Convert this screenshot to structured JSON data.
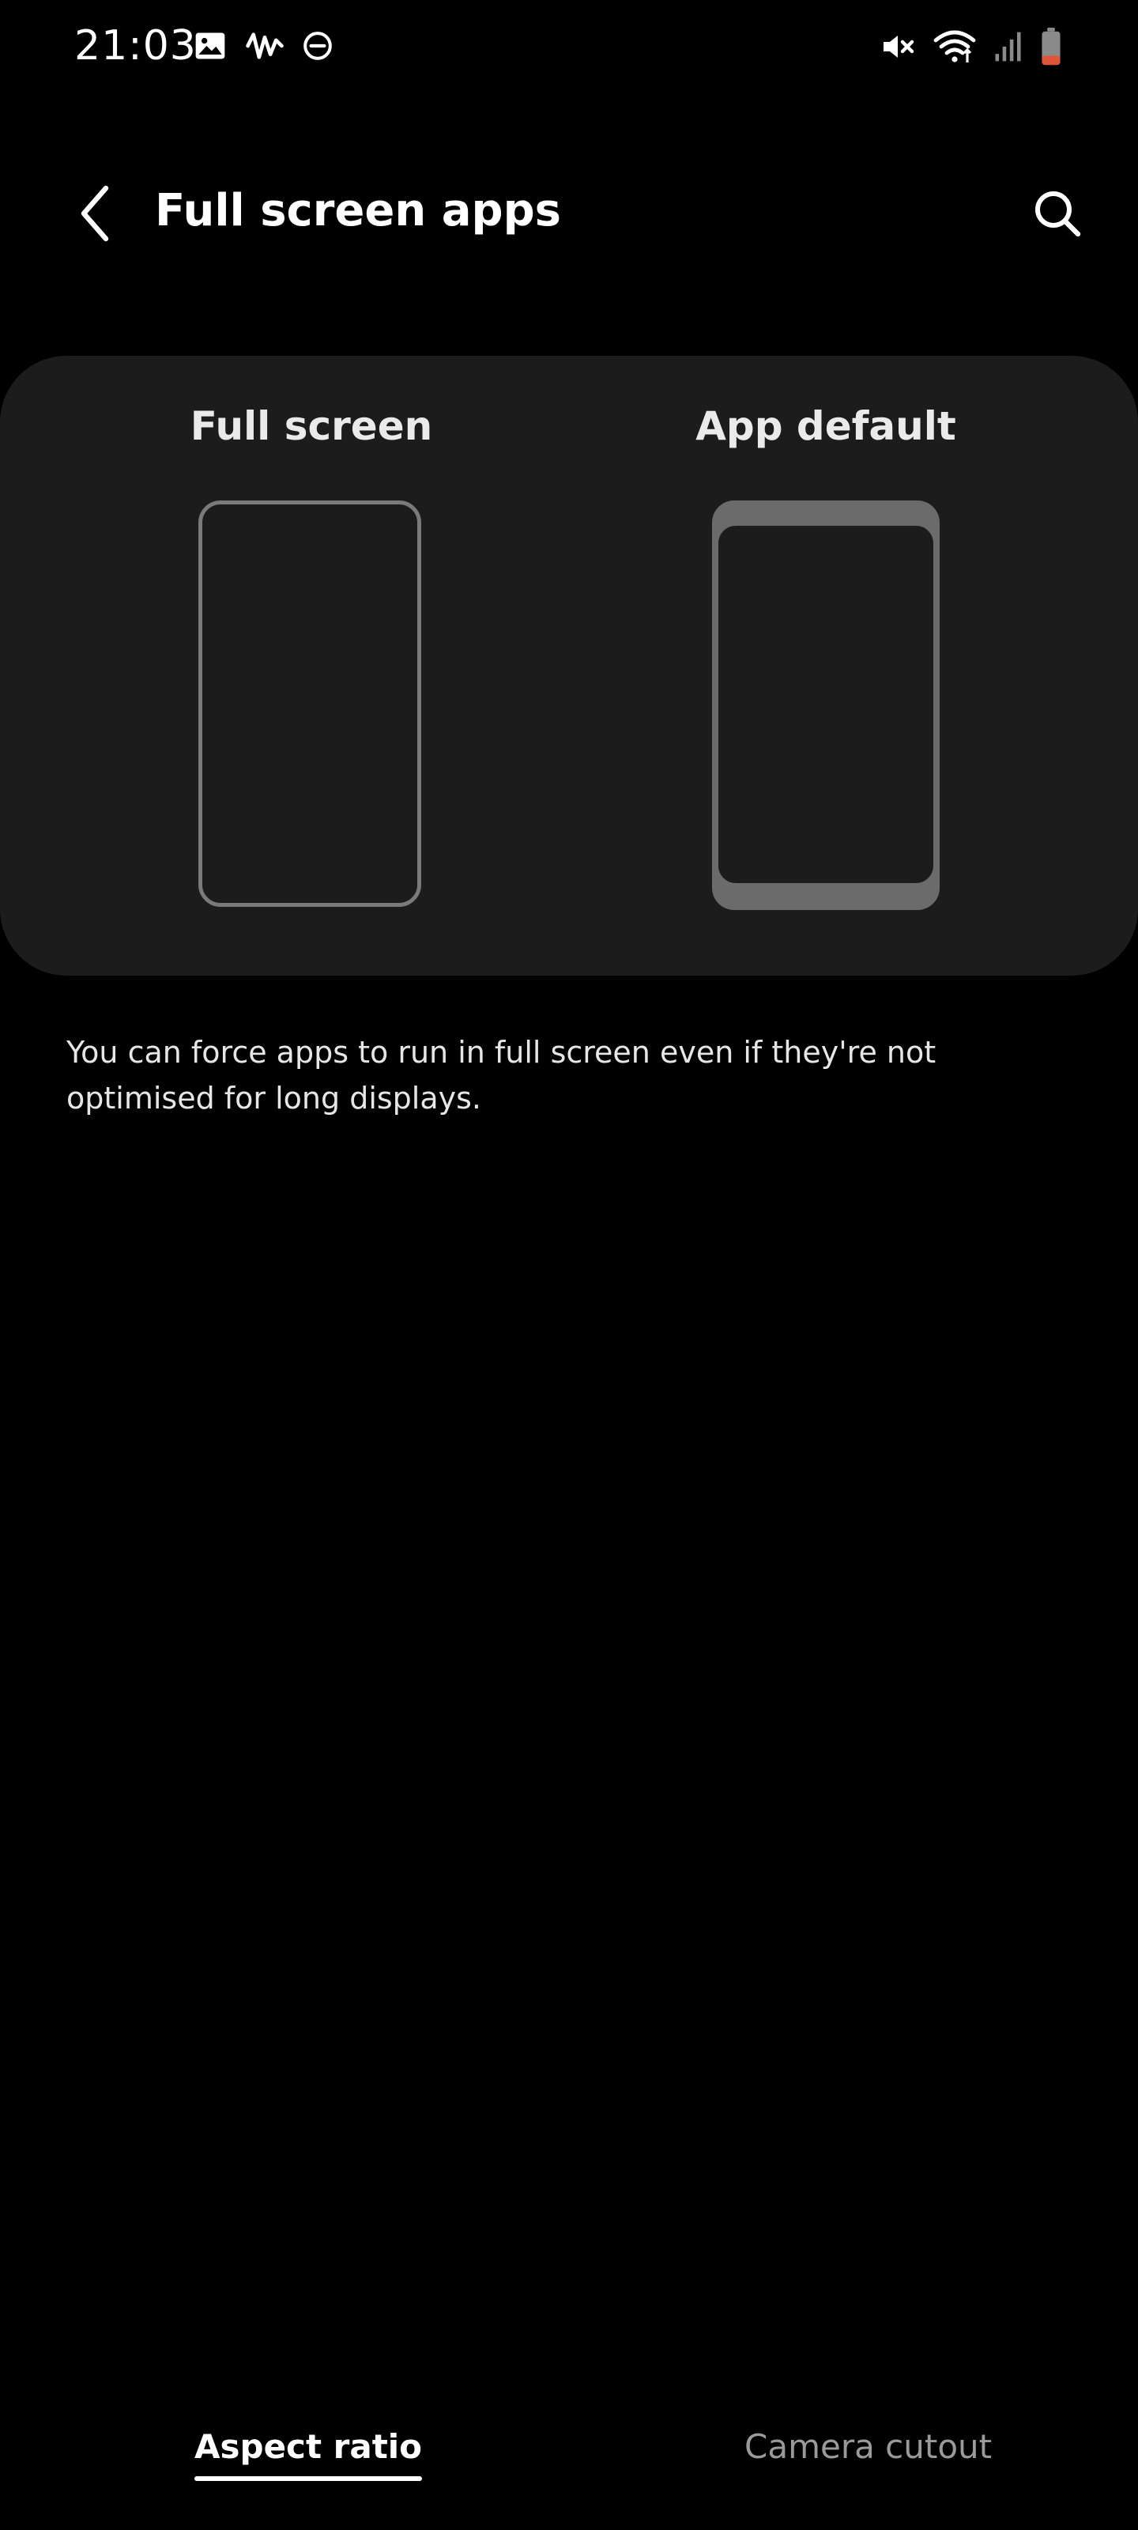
{
  "status_bar": {
    "time": "21:03",
    "left_icons": [
      "gallery-icon",
      "sound-wave-icon",
      "do-not-disturb-icon"
    ],
    "right_icons": [
      "mute-icon",
      "wifi-icon",
      "signal-icon",
      "battery-icon"
    ],
    "battery_color": "#e0553a"
  },
  "app_bar": {
    "title": "Full screen apps"
  },
  "options": {
    "full_screen_label": "Full screen",
    "app_default_label": "App default"
  },
  "description": "You can force apps to run in full screen even if they're not optimised for long displays.",
  "tabs": {
    "aspect_ratio": "Aspect ratio",
    "camera_cutout": "Camera cutout",
    "selected": "aspect_ratio"
  },
  "colors": {
    "background": "#000000",
    "card": "#1c1c1c",
    "text_primary": "#ffffff",
    "text_secondary": "#9a9a9a"
  }
}
